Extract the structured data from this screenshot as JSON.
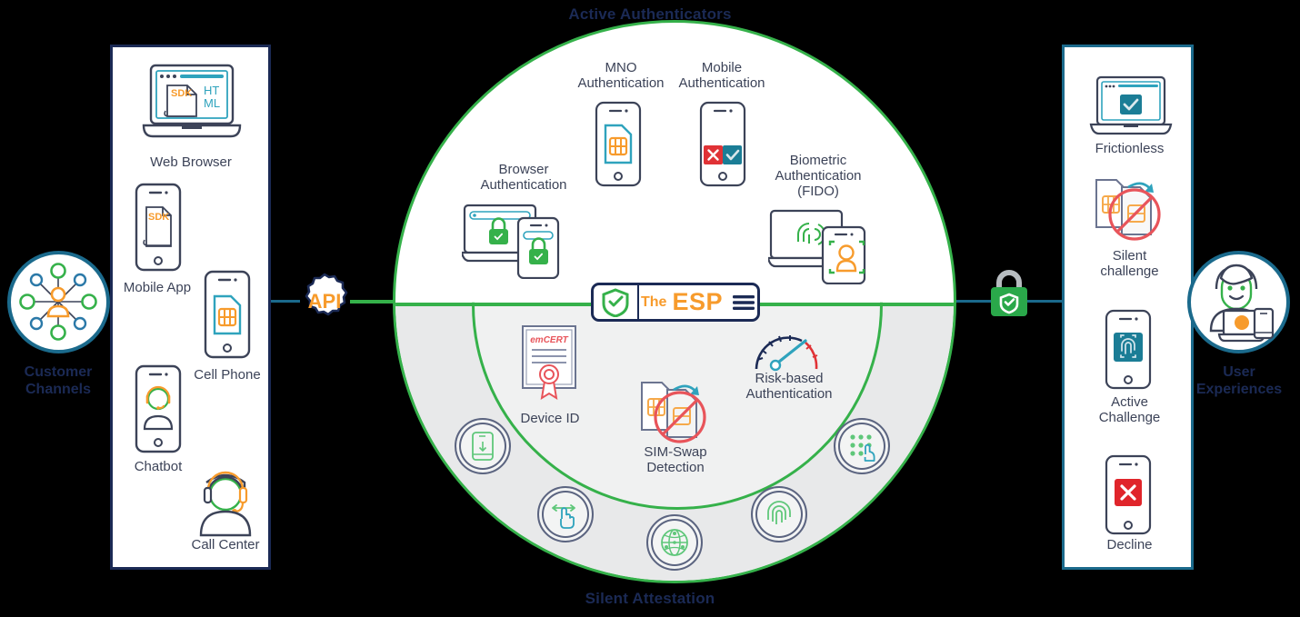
{
  "diagram": {
    "top_band_title": "Active Authenticators",
    "bottom_band_title": "Silent Attestation",
    "colors": {
      "navy": "#1b2a55",
      "green": "#35b14a",
      "orange": "#f79b2c",
      "teal": "#1b6a8c",
      "red": "#e03236",
      "gray_fill": "#e8e9ea"
    }
  },
  "left_endpoint": {
    "label_line1": "Customer",
    "label_line2": "Channels",
    "icon": "network-hub-user-icon"
  },
  "right_endpoint": {
    "label_line1": "User",
    "label_line2": "Experiences",
    "icon": "happy-user-devices-icon"
  },
  "api_node": {
    "label": "API",
    "icon": "gear-icon"
  },
  "lock_node": {
    "icon": "green-padlock-shield-icon"
  },
  "esp": {
    "the_label": "The",
    "esp_label": "ESP",
    "logo_icon": "esp-shield-check-icon",
    "menu_icon": "hamburger-menu-icon"
  },
  "customer_channels": [
    {
      "label": "Web Browser",
      "icon": "laptop-browser-sdk-html-icon",
      "badge_texts": [
        "SDK",
        "HT",
        "ML"
      ]
    },
    {
      "label": "Mobile App",
      "icon": "phone-sdk-icon",
      "badge_texts": [
        "SDK"
      ]
    },
    {
      "label": "Cell Phone",
      "icon": "phone-sim-card-icon",
      "badge_texts": []
    },
    {
      "label": "Chatbot",
      "icon": "phone-headset-agent-icon",
      "badge_texts": []
    },
    {
      "label": "Call Center",
      "icon": "headset-agent-icon",
      "badge_texts": []
    }
  ],
  "active_authenticators": [
    {
      "label": "Browser\nAuthentication",
      "label_lines": [
        "Browser",
        "Authentication"
      ],
      "icon": "laptop-phone-lock-icon"
    },
    {
      "label": "MNO\nAuthentication",
      "label_lines": [
        "MNO",
        "Authentication"
      ],
      "icon": "phone-sim-card-icon"
    },
    {
      "label": "Mobile\nAuthentication",
      "label_lines": [
        "Mobile",
        "Authentication"
      ],
      "icon": "phone-approve-deny-icon"
    },
    {
      "label": "Biometric\nAuthentication\n(FIDO)",
      "label_lines": [
        "Biometric",
        "Authentication",
        "(FIDO)"
      ],
      "icon": "laptop-phone-biometric-icon"
    }
  ],
  "silent_attestation": [
    {
      "label_lines": [
        "Device ID"
      ],
      "icon": "certificate-icon",
      "icon_text": "emCERT"
    },
    {
      "label_lines": [
        "SIM-Swap",
        "Detection"
      ],
      "icon": "sim-swap-blocked-icon"
    },
    {
      "label_lines": [
        "Risk-based",
        "Authentication"
      ],
      "icon": "risk-gauge-icon"
    }
  ],
  "silent_badges": [
    {
      "icon": "mobile-device-badge-icon"
    },
    {
      "icon": "swipe-gesture-badge-icon"
    },
    {
      "icon": "globe-network-badge-icon"
    },
    {
      "icon": "fingerprint-badge-icon"
    },
    {
      "icon": "keypad-tap-badge-icon"
    }
  ],
  "user_experiences": [
    {
      "label_lines": [
        "Frictionless"
      ],
      "icon": "laptop-check-icon"
    },
    {
      "label_lines": [
        "Silent",
        "challenge"
      ],
      "icon": "sim-swap-blocked-icon"
    },
    {
      "label_lines": [
        "Active",
        "Challenge"
      ],
      "icon": "phone-biometric-icon"
    },
    {
      "label_lines": [
        "Decline"
      ],
      "icon": "phone-decline-x-icon"
    }
  ]
}
